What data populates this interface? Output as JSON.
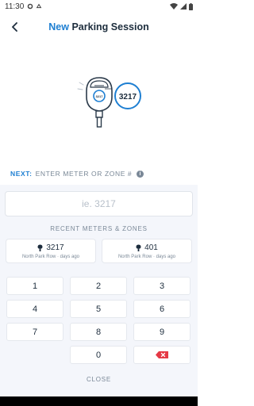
{
  "status_bar": {
    "time": "11:30"
  },
  "header": {
    "title_accent": "New",
    "title_rest": " Parking Session"
  },
  "illustration": {
    "meter_code": "3217",
    "bubble_number": "3217"
  },
  "prompt": {
    "label": "NEXT:",
    "text": "ENTER METER OR ZONE #"
  },
  "input": {
    "placeholder": "ie. 3217",
    "value": ""
  },
  "recent": {
    "title": "RECENT METERS & ZONES",
    "items": [
      {
        "number": "3217",
        "location": "North Park Row",
        "separator": "·",
        "when": "days ago"
      },
      {
        "number": "401",
        "location": "North Park Row",
        "separator": "·",
        "when": "days ago"
      }
    ]
  },
  "keypad": {
    "keys": [
      "1",
      "2",
      "3",
      "4",
      "5",
      "6",
      "7",
      "8",
      "9",
      "0"
    ]
  },
  "close_label": "CLOSE",
  "colors": {
    "accent": "#1e7fd2",
    "delete": "#e53945",
    "panel": "#f4f6fb"
  }
}
